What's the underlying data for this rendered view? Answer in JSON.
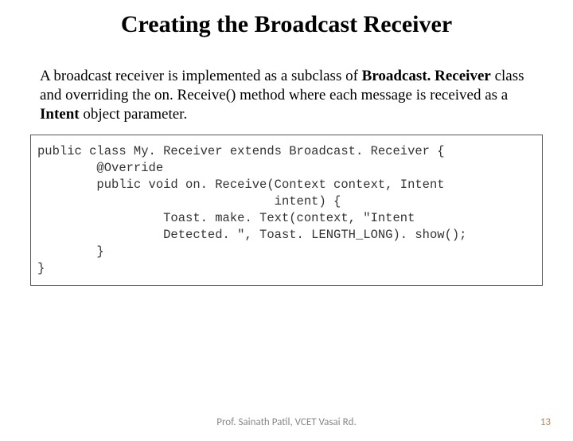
{
  "title": "Creating the Broadcast Receiver",
  "paragraph_parts": {
    "p1": "A broadcast receiver is implemented as a subclass of ",
    "bold1": "Broadcast. Receiver",
    "p2": " class and overriding the on. Receive() method where each message is received as a ",
    "bold2": "Intent",
    "p3": " object parameter."
  },
  "code": "public class My. Receiver extends Broadcast. Receiver {\n        @Override\n        public void on. Receive(Context context, Intent\n                                intent) {\n                 Toast. make. Text(context, \"Intent\n                 Detected. \", Toast. LENGTH_LONG). show();\n        }\n}",
  "footer": {
    "credit": "Prof. Sainath Patil, VCET Vasai Rd.",
    "page": "13"
  }
}
